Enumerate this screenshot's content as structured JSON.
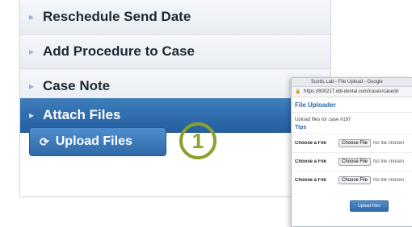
{
  "menu": {
    "items": [
      {
        "label": "Reschedule Send Date",
        "active": false
      },
      {
        "label": "Add Procedure to Case",
        "active": false
      },
      {
        "label": "Case Note",
        "active": false
      },
      {
        "label": "Attach Files",
        "active": true
      }
    ],
    "upload_button": "Upload Files"
  },
  "step_number": "1",
  "popup": {
    "window_title": "Scotts Lab - File Upload - Google",
    "url": "https://800217.ddi-dental.com/cases/case/id",
    "title": "File Uploader",
    "text": "Upload files for case #187",
    "tips": "Tips",
    "rows": [
      {
        "label": "Choose a File",
        "button": "Choose File",
        "status": "No file chosen"
      },
      {
        "label": "Choose a File",
        "button": "Choose File",
        "status": "No file chosen"
      },
      {
        "label": "Choose a File",
        "button": "Choose File",
        "status": "No file chosen"
      }
    ],
    "upload_button": "Upload Files"
  },
  "colors": {
    "accent": "#2f69a8",
    "step_circle": "#8aa22b"
  }
}
